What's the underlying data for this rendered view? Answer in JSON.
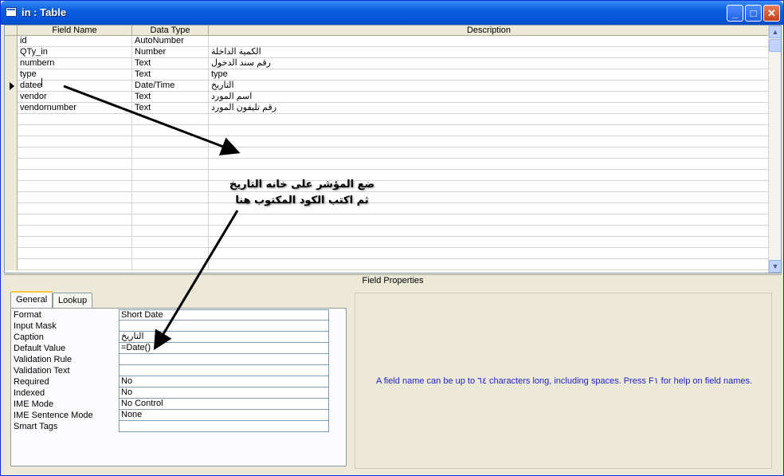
{
  "window": {
    "title": "in : Table",
    "minimize_glyph": "_",
    "maximize_glyph": "□",
    "close_glyph": "✕"
  },
  "grid": {
    "headers": [
      "Field Name",
      "Data Type",
      "Description"
    ],
    "rows": [
      {
        "field": "id",
        "type": "AutoNumber",
        "desc": ""
      },
      {
        "field": "QTy_in",
        "type": "Number",
        "desc": "الكمية الداخلة"
      },
      {
        "field": "numbern",
        "type": "Text",
        "desc": "رقم سند الدخول"
      },
      {
        "field": "type",
        "type": "Text",
        "desc": "type"
      },
      {
        "field": "datee",
        "type": "Date/Time",
        "desc": "التاريخ"
      },
      {
        "field": "vendor",
        "type": "Text",
        "desc": "اسم المورد"
      },
      {
        "field": "vendornumber",
        "type": "Text",
        "desc": "رقم تليفون المورد"
      }
    ],
    "current_row_index": 4
  },
  "field_properties": {
    "label": "Field Properties",
    "tabs": [
      {
        "label": "General",
        "active": true
      },
      {
        "label": "Lookup",
        "active": false
      }
    ],
    "properties": [
      {
        "label": "Format",
        "value": "Short Date"
      },
      {
        "label": "Input Mask",
        "value": ""
      },
      {
        "label": "Caption",
        "value": "التاريخ"
      },
      {
        "label": "Default Value",
        "value": "=Date()"
      },
      {
        "label": "Validation Rule",
        "value": ""
      },
      {
        "label": "Validation Text",
        "value": ""
      },
      {
        "label": "Required",
        "value": "No"
      },
      {
        "label": "Indexed",
        "value": "No"
      },
      {
        "label": "IME Mode",
        "value": "No Control"
      },
      {
        "label": "IME Sentence Mode",
        "value": "None"
      },
      {
        "label": "Smart Tags",
        "value": ""
      }
    ],
    "help_text": "A field name can be up to ٦٤ characters long, including spaces.  Press F١ for help on field names."
  },
  "annotation": {
    "line1": "ضع المؤشر على خانه التاريخ",
    "line2": "ثم اكتب الكود المكتوب هنا"
  }
}
